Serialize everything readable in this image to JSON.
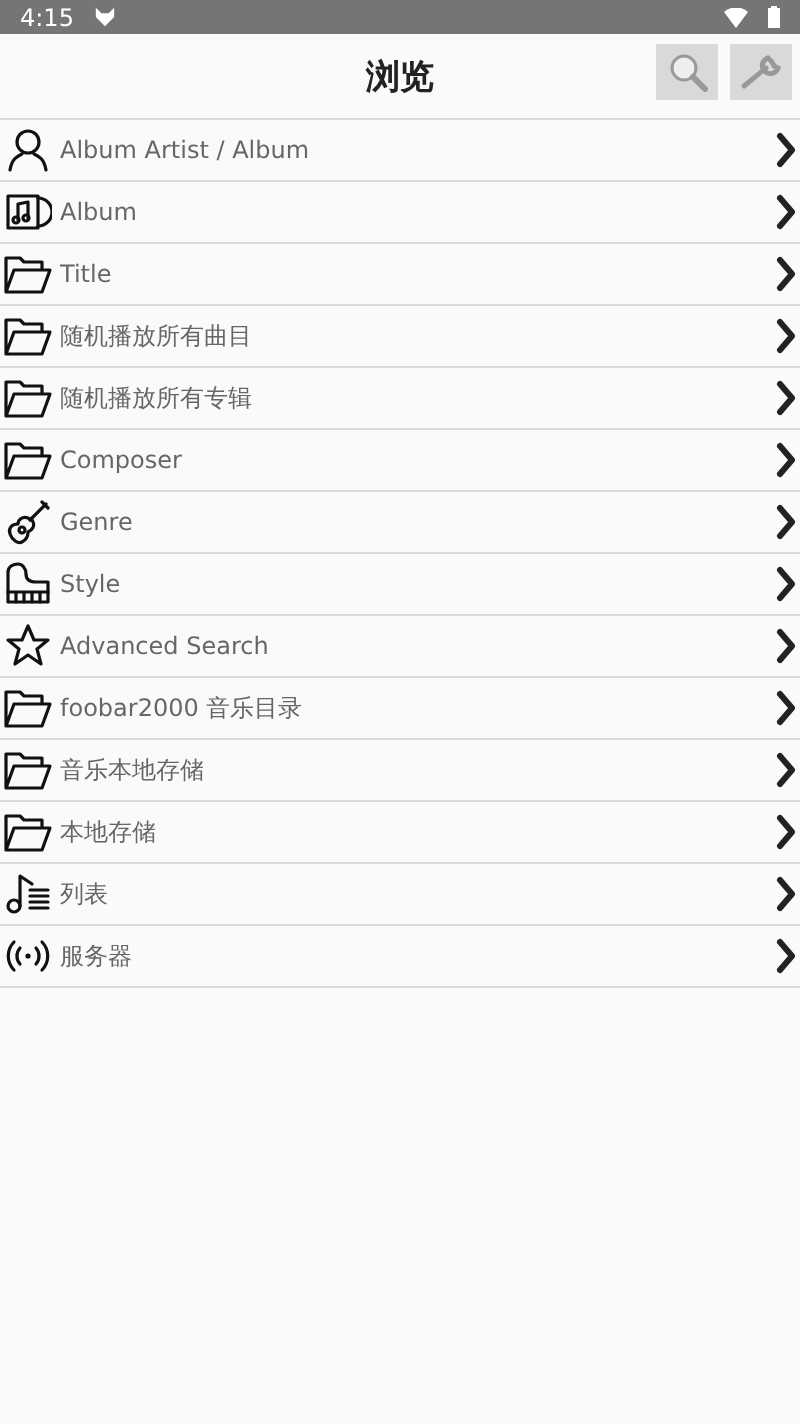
{
  "status_bar": {
    "time": "4:15"
  },
  "header": {
    "title": "浏览"
  },
  "items": [
    {
      "kind": "person",
      "label": "Album Artist / Album"
    },
    {
      "kind": "album",
      "label": "Album"
    },
    {
      "kind": "folder",
      "label": "Title"
    },
    {
      "kind": "folder",
      "label": "随机播放所有曲目"
    },
    {
      "kind": "folder",
      "label": "随机播放所有专辑"
    },
    {
      "kind": "folder",
      "label": "Composer"
    },
    {
      "kind": "guitar",
      "label": "Genre"
    },
    {
      "kind": "piano",
      "label": "Style"
    },
    {
      "kind": "star",
      "label": "Advanced Search"
    },
    {
      "kind": "folder",
      "label": "foobar2000 音乐目录"
    },
    {
      "kind": "folder",
      "label": "音乐本地存储"
    },
    {
      "kind": "folder",
      "label": "本地存储"
    },
    {
      "kind": "list",
      "label": "列表"
    },
    {
      "kind": "server",
      "label": "服务器"
    }
  ]
}
